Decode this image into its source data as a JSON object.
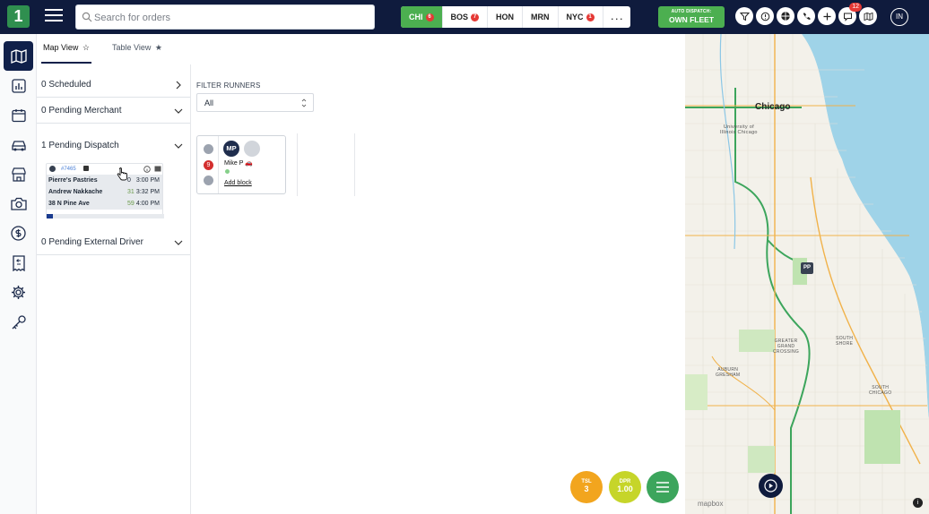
{
  "app": {
    "logo_glyph": "1",
    "brand_color": "#2f8f4f",
    "header_color": "#0f1b3d",
    "accent_color": "#4caf50"
  },
  "search": {
    "placeholder": "Search for orders"
  },
  "cities": [
    {
      "label": "CHI",
      "count": "6",
      "active": true
    },
    {
      "label": "BOS",
      "count": "7",
      "active": false
    },
    {
      "label": "HON",
      "count": "",
      "active": false
    },
    {
      "label": "MRN",
      "count": "",
      "active": false
    },
    {
      "label": "NYC",
      "count": "1",
      "active": false
    },
    {
      "label": ". . .",
      "count": "",
      "active": false
    }
  ],
  "auto_dispatch": {
    "line1": "AUTO DISPATCH:",
    "line2": "OWN FLEET"
  },
  "toolbar": {
    "messages_count": "12",
    "user_initials": "IN"
  },
  "sidebar_icons": [
    "map-icon",
    "chart-icon",
    "calendar-icon",
    "car-icon",
    "store-icon",
    "camera-icon",
    "dollar-icon",
    "receipt-icon",
    "gear-icon",
    "key-icon"
  ],
  "tabs": [
    {
      "label": "Map View",
      "active": true
    },
    {
      "label": "Table View",
      "active": false
    }
  ],
  "queue": {
    "scheduled": "0 Scheduled",
    "pending_merchant": "0 Pending Merchant",
    "pending_dispatch": "1 Pending Dispatch",
    "pending_external": "0 Pending External Driver"
  },
  "order": {
    "id": "#7465",
    "lines": [
      {
        "name": "Pierre's Pastries",
        "num": "0",
        "time": "3:00 PM"
      },
      {
        "name": "Andrew Nakkache",
        "num": "31",
        "time": "3:32 PM"
      },
      {
        "name": "38 N Pine Ave",
        "num": "59",
        "time": "4:00 PM"
      }
    ],
    "progress": 0.05
  },
  "filter": {
    "label": "FILTER RUNNERS",
    "value": "All"
  },
  "runner": {
    "initials": "MP",
    "name": "Mike P",
    "status_num": "9",
    "add_block": "Add block"
  },
  "map": {
    "city_label": "Chicago",
    "university": "University of\nIllinois Chicago",
    "greater_grand": "GREATER\nGRAND\nCROSSING",
    "south_shore": "SOUTH\nSHORE",
    "south_chicago": "SOUTH\nCHICAGO",
    "auburn": "AUBURN\nGRESHAM",
    "marker": "PP",
    "attribution": "mapbox"
  },
  "bottom_stats": {
    "tsl_label": "TSL",
    "tsl_value": "3",
    "dpr_label": "DPR",
    "dpr_value": "1.00"
  }
}
